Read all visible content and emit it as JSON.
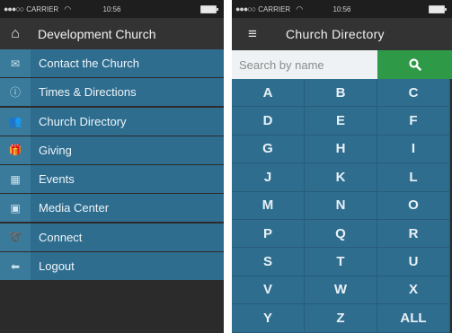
{
  "left_screen": {
    "status": {
      "carrier": "CARRIER",
      "time": "10:56"
    },
    "header": {
      "title": "Development Church",
      "home_icon": "home-icon"
    },
    "menu": [
      {
        "label": "Contact the Church",
        "icon": "envelope-icon"
      },
      {
        "label": "Times & Directions",
        "icon": "info-icon"
      },
      {
        "label": "Church Directory",
        "icon": "people-icon"
      },
      {
        "label": "Giving",
        "icon": "gift-icon"
      },
      {
        "label": "Events",
        "icon": "calendar-icon"
      },
      {
        "label": "Media Center",
        "icon": "image-icon"
      },
      {
        "label": "Connect",
        "icon": "connect-icon"
      },
      {
        "label": "Logout",
        "icon": "arrow-left-icon"
      }
    ]
  },
  "right_screen": {
    "status": {
      "carrier": "CARRIER",
      "time": "10:56"
    },
    "header": {
      "title": "Church Directory",
      "menu_icon": "hamburger-icon"
    },
    "search": {
      "placeholder": "Search by name",
      "button_icon": "search-icon"
    },
    "letters": [
      "A",
      "B",
      "C",
      "D",
      "E",
      "F",
      "G",
      "H",
      "I",
      "J",
      "K",
      "L",
      "M",
      "N",
      "O",
      "P",
      "Q",
      "R",
      "S",
      "T",
      "U",
      "V",
      "W",
      "X",
      "Y",
      "Z",
      "ALL"
    ]
  },
  "colors": {
    "menu_bg": "#2f6d8f",
    "header_bg": "#333333",
    "search_button": "#2e9a48"
  }
}
